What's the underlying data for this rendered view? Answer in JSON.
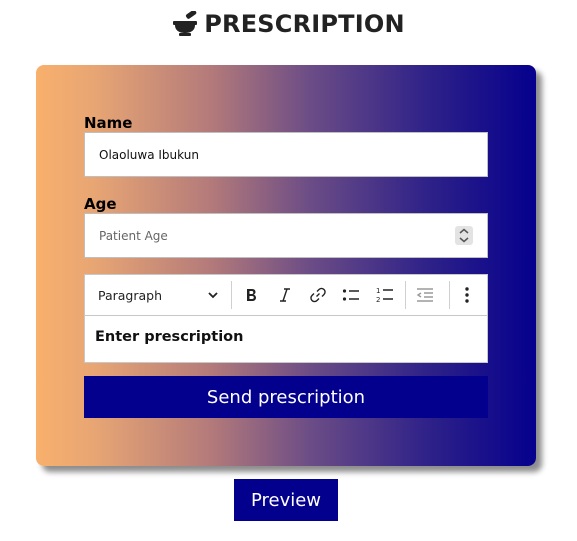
{
  "header": {
    "icon": "mortar-pestle-icon",
    "title": "PRESCRIPTION"
  },
  "form": {
    "name_label": "Name",
    "name_value": "Olaoluwa Ibukun",
    "age_label": "Age",
    "age_placeholder": "Patient Age",
    "editor": {
      "block_type": "Paragraph",
      "toolbar_icons": [
        "chevron-down-icon",
        "bold-icon",
        "italic-icon",
        "link-icon",
        "bulleted-list-icon",
        "numbered-list-icon",
        "outdent-icon",
        "more-vertical-icon"
      ],
      "content": "Enter prescription"
    },
    "send_label": "Send prescription"
  },
  "preview_label": "Preview",
  "colors": {
    "accent": "#03008e",
    "gradient_start": "#f8b06c",
    "gradient_end": "#05008d"
  }
}
